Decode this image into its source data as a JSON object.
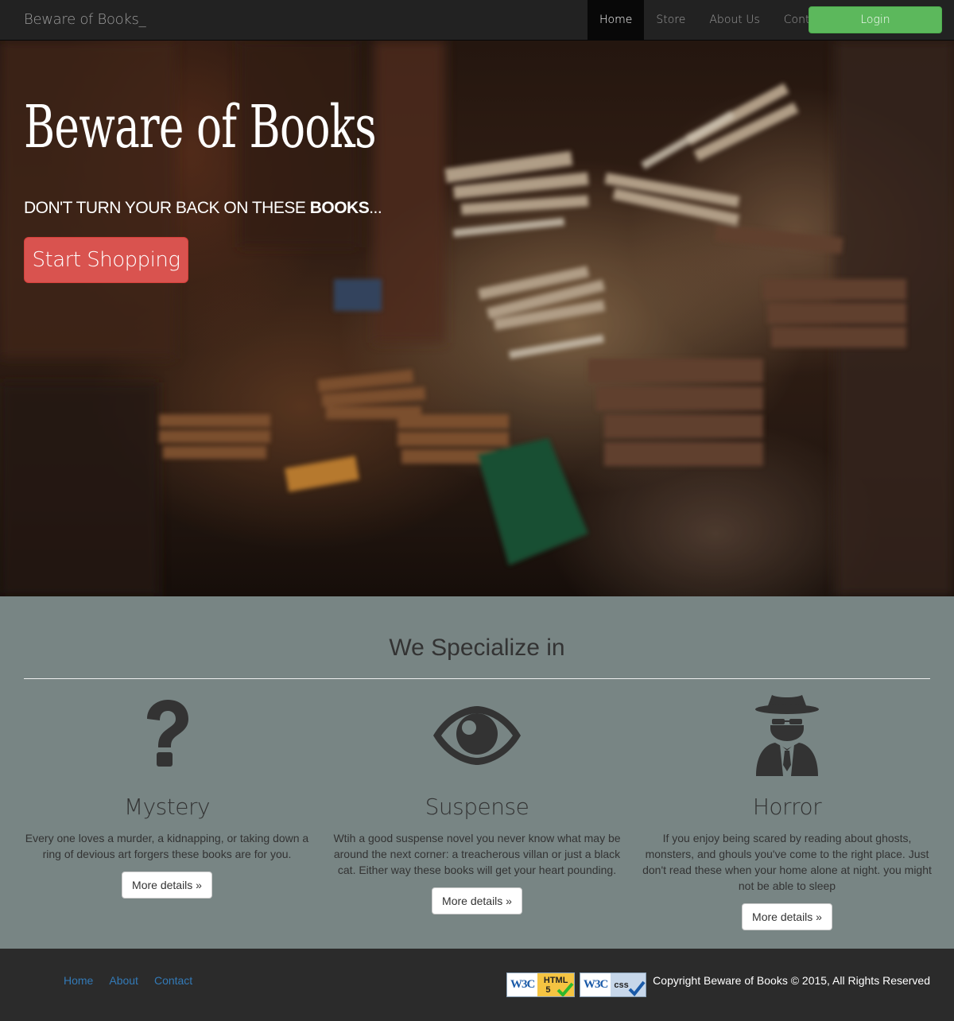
{
  "navbar": {
    "brand": "Beware of Books_",
    "links": [
      {
        "label": "Home",
        "active": true
      },
      {
        "label": "Store",
        "active": false
      },
      {
        "label": "About Us",
        "active": false
      },
      {
        "label": "Contact",
        "active": false
      }
    ],
    "login_label": "Login"
  },
  "hero": {
    "title": "Beware of Books",
    "subtitle_pre": "DON'T TURN YOUR BACK ON THESE ",
    "subtitle_bold": "BOOKS",
    "subtitle_post": "...",
    "cta_label": "Start Shopping"
  },
  "specialize": {
    "title": "We Specialize in",
    "genres": [
      {
        "icon": "question-mark-icon",
        "name": "Mystery",
        "text": "Every one loves a murder, a kidnapping, or taking down a ring of devious art forgers these books are for you.",
        "button": "More details »"
      },
      {
        "icon": "eye-icon",
        "name": "Suspense",
        "text": "Wtih a good suspense novel you never know what may be around the next corner: a treacherous villan or just a black cat. Either way these books will get your heart pounding.",
        "button": "More details »"
      },
      {
        "icon": "spy-icon",
        "name": "Horror",
        "text": "If you enjoy being scared by reading about ghosts, monsters, and ghouls you've come to the right place. Just don't read these when your home alone at night. you might not be able to sleep",
        "button": "More details »"
      }
    ]
  },
  "footer": {
    "links": [
      "Home",
      "About",
      "Contact"
    ],
    "badges": [
      {
        "logo": "W3C",
        "label": "HTML",
        "sub": "5"
      },
      {
        "logo": "W3C",
        "label": "css",
        "sub": ""
      }
    ],
    "copyright": "Copyright Beware of Books © 2015, All Rights Reserved"
  },
  "colors": {
    "navbar": "#222222",
    "login": "#5cb85c",
    "cta": "#d9534f",
    "section": "#788584",
    "footer": "#2b2b2b",
    "link": "#337ab7"
  }
}
